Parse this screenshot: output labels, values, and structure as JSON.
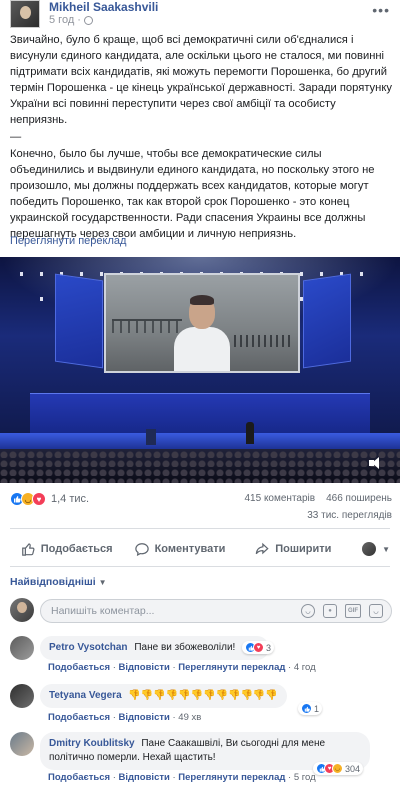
{
  "post": {
    "author": "Mikheil Saakashvili",
    "time": "5 год",
    "paragraph_uk": "Звичайно, було б краще, щоб всі демократичні сили об'єдналися і висунули єдиного кандидата, але оскільки цього не сталося, ми повинні підтримати всіх кандидатів, які можуть перемогти Порошенка, бо другий термін Порошенка - це кінець української державності. Заради порятунку України всі повинні переступити через свої амбіції та особисту неприязнь.",
    "separator": "—",
    "paragraph_ru": "Конечно, было бы лучше, чтобы все демократические силы объединились и выдвинули единого кандидата, но поскольку этого не произошло, мы должны поддержать всех кандидатов, которые могут победить Порошенко, так как второй срок Порошенко - это конец украинской государственности. Ради спасения Украины все должны перешагнуть через свои амбиции и личную неприязнь.",
    "translate_link": "Переглянути переклад"
  },
  "stats": {
    "reactions_count": "1,4 тис.",
    "comments": "415 коментарів",
    "shares": "466 поширень",
    "views": "33 тис. переглядів"
  },
  "actions": {
    "like": "Подобається",
    "comment": "Коментувати",
    "share": "Поширити"
  },
  "comments_section": {
    "sort_label": "Найвідповідніші",
    "input_placeholder": "Напишіть коментар..."
  },
  "comments": [
    {
      "name": "Petro Vysotchan",
      "text": "Пане ви збожеволіли!",
      "like": "Подобається",
      "reply": "Відповісти",
      "translate": "Переглянути переклад",
      "time": "4 год",
      "reactions": "3"
    },
    {
      "name": "Tetyana Vegera",
      "text": "👎👎👎👎👎👎👎👎👎👎👎👎",
      "like": "Подобається",
      "reply": "Відповісти",
      "time": "49 хв",
      "reactions": "1"
    },
    {
      "name": "Dmitry Koublitsky",
      "text": "Пане Саакашвілі, Ви сьогодні для мене політично померли. Нехай щастить!",
      "like": "Подобається",
      "reply": "Відповісти",
      "translate": "Переглянути переклад",
      "time": "5 год",
      "reactions": "304"
    }
  ],
  "colors": {
    "link": "#385898",
    "secondary_text": "#606770",
    "like_blue": "#1877f2",
    "love_red": "#f33e58",
    "haha_yellow": "#f7b125"
  },
  "icons": {
    "like": "thumbs-up-icon",
    "comment": "speech-bubble-icon",
    "share": "share-arrow-icon",
    "more": "ellipsis-icon",
    "volume": "speaker-icon",
    "privacy": "globe-icon"
  }
}
